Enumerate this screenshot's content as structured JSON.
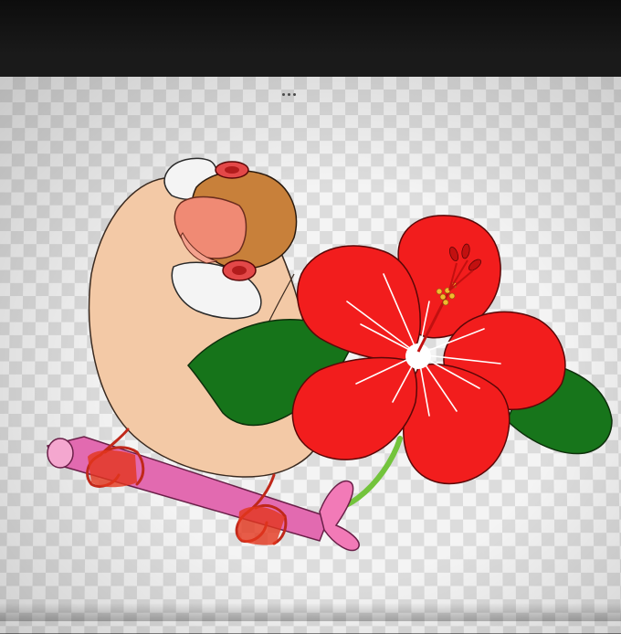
{
  "toolbar": {
    "more_menu_icon": "more-horizontal-icon"
  },
  "canvas": {
    "background": "transparency-checkerboard"
  },
  "artwork": {
    "subject": "java-sparrow-on-perch-with-hibiscus",
    "colors": {
      "bird_body": "#f3c9a6",
      "bird_head": "#c8803a",
      "bird_cheek": "#f2f2f2",
      "beak": "#f08a74",
      "eye_ring": "#e34848",
      "hibiscus": "#f21d1d",
      "leaf": "#16741a",
      "perch": "#e26ab0",
      "bow": "#f27ab7",
      "feet": "#e3361d",
      "stem": "#72c23b",
      "stamen": "#f2b92e"
    }
  }
}
